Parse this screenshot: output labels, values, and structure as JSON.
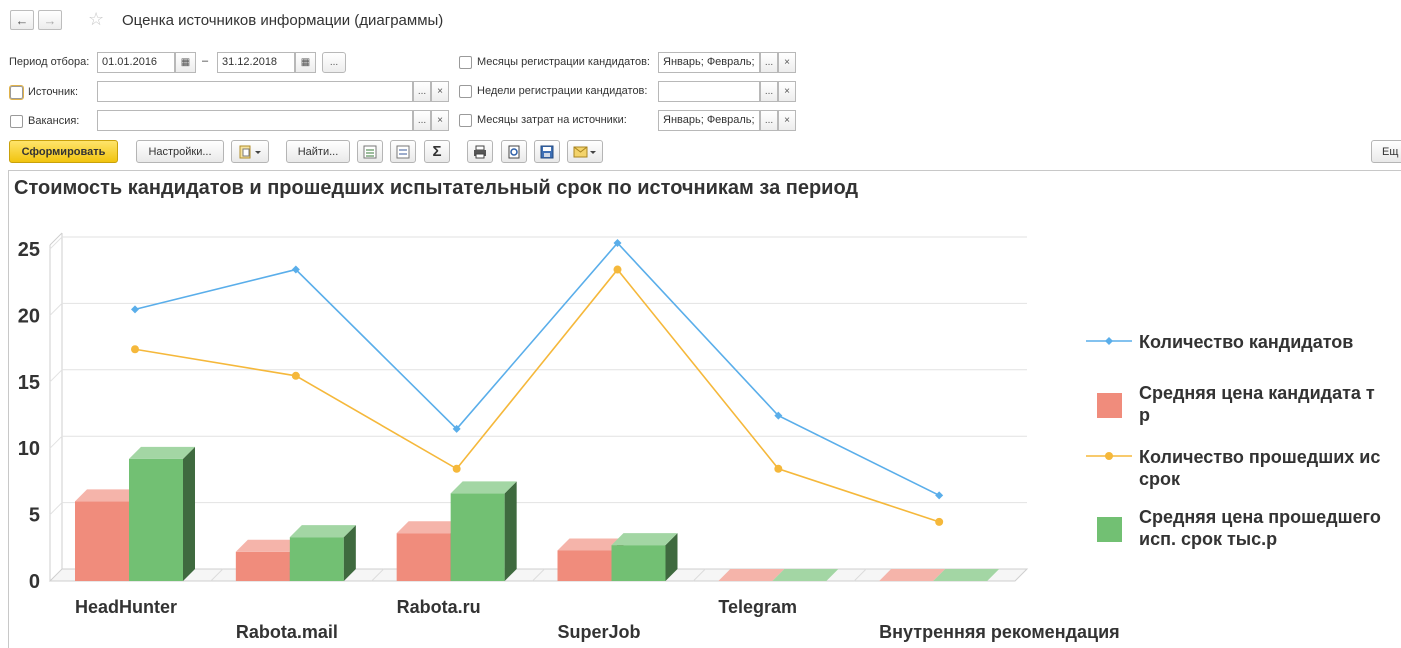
{
  "window": {
    "title": "Оценка источников информации (диаграммы)",
    "back_icon": "←",
    "forward_icon": "→",
    "star_icon": "☆"
  },
  "filters": {
    "period_label": "Период отбора:",
    "period_from": "01.01.2016",
    "period_dash": "–",
    "period_to": "31.12.2018",
    "ellipsis": "...",
    "source_label": "Источник:",
    "source_value": "",
    "vacancy_label": "Вакансия:",
    "vacancy_value": "",
    "clear_icon": "×",
    "months_reg_label": "Месяцы регистрации кандидатов:",
    "months_reg_value": "Январь; Февраль;",
    "weeks_reg_label": "Недели регистрации кандидатов:",
    "weeks_reg_value": "",
    "months_cost_label": "Месяцы затрат на источники:",
    "months_cost_value": "Январь; Февраль;",
    "calendar_icon": "▦"
  },
  "toolbar": {
    "generate": "Сформировать",
    "settings": "Настройки...",
    "find": "Найти...",
    "sum_icon": "Σ",
    "more": "Ещ"
  },
  "report": {
    "title": "Стоимость кандидатов  и прошедших испытательный срок по источникам за период"
  },
  "chart_data": {
    "type": "bar",
    "categories": [
      "HeadHunter",
      "Rabota.mail",
      "Rabota.ru",
      "SuperJob",
      "Telegram",
      "Внутренняя рекомендация"
    ],
    "ylim": [
      0,
      25
    ],
    "yticks": [
      "0",
      "5",
      "10",
      "15",
      "20",
      "25"
    ],
    "series": [
      {
        "name": "Количество кандидатов",
        "kind": "line",
        "color": "#5aaeea",
        "values": [
          20,
          23,
          11,
          25,
          12,
          6
        ]
      },
      {
        "name": "Средняя цена кандидата тыс.р",
        "legend_lines": [
          "Средняя цена кандидата т",
          "р"
        ],
        "kind": "bar",
        "color": "#f08c7c",
        "values": [
          6,
          2.2,
          3.6,
          2.3,
          0,
          0
        ]
      },
      {
        "name": "Количество прошедших исп. срок",
        "legend_lines": [
          "Количество прошедших ис",
          "срок"
        ],
        "kind": "line",
        "color": "#f5b83b",
        "values": [
          17,
          15,
          8,
          23,
          8,
          4
        ]
      },
      {
        "name": "Средняя цена прошедшего исп. срок тыс.р",
        "legend_lines": [
          "Средняя цена прошедшего",
          "исп. срок тыс.р"
        ],
        "kind": "bar",
        "color": "#72c073",
        "values": [
          9.2,
          3.3,
          6.6,
          2.7,
          0,
          0
        ]
      }
    ],
    "legend": "right",
    "grid": true
  }
}
